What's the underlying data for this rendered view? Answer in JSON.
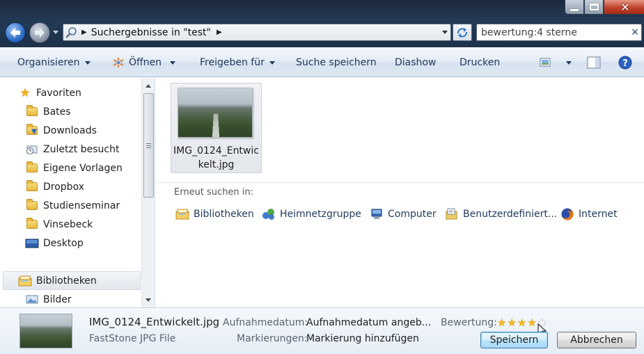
{
  "window": {
    "close_label": "✕"
  },
  "address": {
    "path_label": "Suchergebnisse in \"test\""
  },
  "search": {
    "value": "bewertung:4 sterne",
    "clear_label": "✕"
  },
  "toolbar": {
    "organize": "Organisieren",
    "open": "Öffnen",
    "share": "Freigeben für",
    "save_search": "Suche speichern",
    "slideshow": "Diashow",
    "print": "Drucken"
  },
  "nav": {
    "items": [
      {
        "label": "Favoriten",
        "icon": "star-icon"
      },
      {
        "label": "Bates",
        "icon": "folder-icon"
      },
      {
        "label": "Downloads",
        "icon": "downloads-folder-icon"
      },
      {
        "label": "Zuletzt besucht",
        "icon": "recent-places-icon"
      },
      {
        "label": "Eigene Vorlagen",
        "icon": "folder-icon"
      },
      {
        "label": "Dropbox",
        "icon": "folder-icon"
      },
      {
        "label": "Studienseminar",
        "icon": "folder-icon"
      },
      {
        "label": "Vinsebeck",
        "icon": "folder-icon"
      },
      {
        "label": "Desktop",
        "icon": "desktop-icon"
      },
      {
        "label": "Bibliotheken",
        "icon": "libraries-icon"
      },
      {
        "label": "Bilder",
        "icon": "pictures-library-icon"
      }
    ]
  },
  "content": {
    "file": {
      "name_line1": "IMG_0124_Entwic",
      "name_line2": "kelt.jpg"
    },
    "search_again_label": "Erneut suchen in:",
    "search_again_items": [
      {
        "label": "Bibliotheken",
        "icon": "libraries-icon"
      },
      {
        "label": "Heimnetzgruppe",
        "icon": "homegroup-icon"
      },
      {
        "label": "Computer",
        "icon": "computer-icon"
      },
      {
        "label": "Benutzerdefiniert...",
        "icon": "custom-folder-icon"
      },
      {
        "label": "Internet",
        "icon": "firefox-icon"
      }
    ]
  },
  "details": {
    "filename": "IMG_0124_Entwickelt.jpg",
    "filetype": "FastStone JPG File",
    "date_taken_key": "Aufnahmedatum:",
    "date_taken_value": "Aufnahmedatum angeb...",
    "tags_key": "Markierungen:",
    "tags_value": "Markierung hinzufügen",
    "rating_key": "Bewertung:",
    "rating_value": 4,
    "rating_max": 5,
    "save_button": "Speichern",
    "cancel_button": "Abbrechen"
  }
}
